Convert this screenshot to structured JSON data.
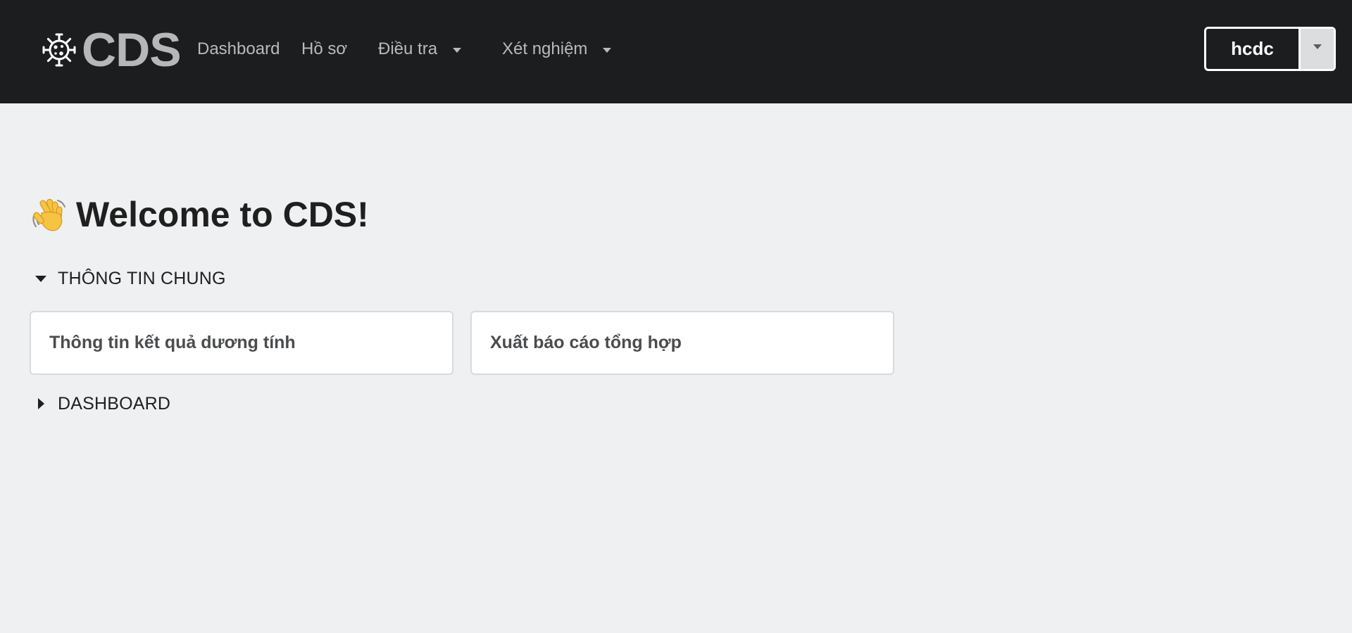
{
  "brand": {
    "icon": "virus-icon",
    "name": "CDS"
  },
  "nav": {
    "items": [
      {
        "label": "Dashboard",
        "has_dropdown": false
      },
      {
        "label": "Hồ sơ",
        "has_dropdown": false
      },
      {
        "label": "Điều tra",
        "has_dropdown": true
      },
      {
        "label": "Xét nghiệm",
        "has_dropdown": true
      }
    ]
  },
  "user": {
    "name": "hcdc",
    "toggle_icon": "caret-down-icon"
  },
  "main": {
    "welcome_icon": "waving-hand-icon",
    "welcome": "Welcome to CDS!",
    "sections": [
      {
        "label": "THÔNG TIN CHUNG",
        "expanded": true,
        "cards": [
          {
            "label": "Thông tin kết quả dương tính"
          },
          {
            "label": "Xuất báo cáo tổng hợp"
          }
        ]
      },
      {
        "label": "DASHBOARD",
        "expanded": false
      }
    ]
  },
  "colors": {
    "navbar_bg": "#1c1d1f",
    "page_bg": "#eff0f1",
    "card_bg": "#ffffff",
    "nav_text": "#b9babb",
    "heading_text": "#1f1f1f"
  }
}
